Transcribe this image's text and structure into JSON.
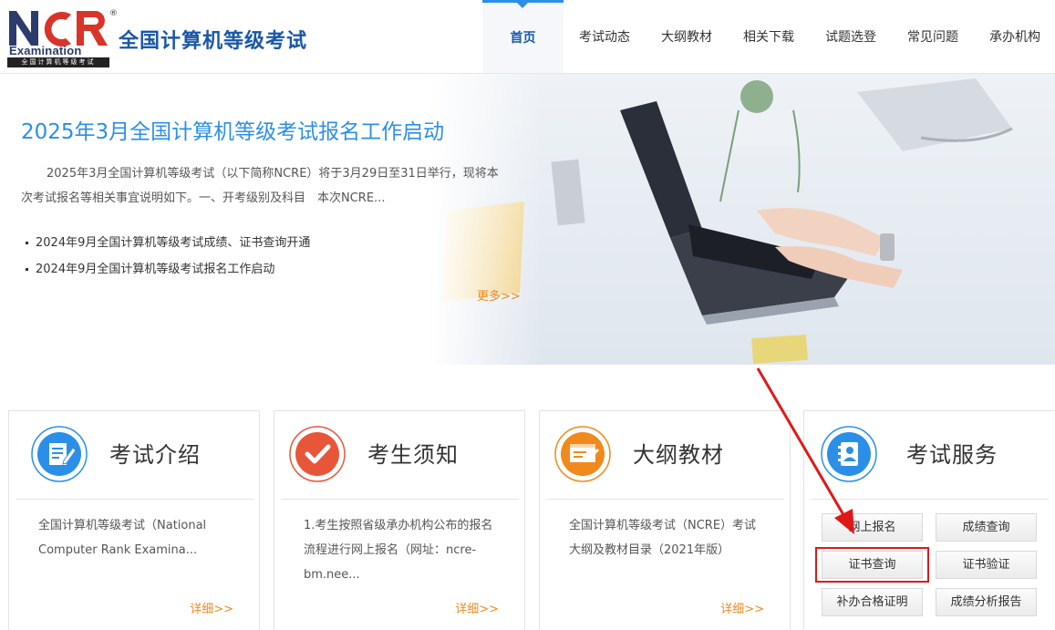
{
  "header": {
    "logo_letters": "NCR",
    "logo_examination": "Examination",
    "logo_strip": "全国计算机等级考试",
    "logo_registered": "®",
    "site_title": "全国计算机等级考试",
    "nav": [
      {
        "label": "首页",
        "active": true
      },
      {
        "label": "考试动态"
      },
      {
        "label": "大纲教材"
      },
      {
        "label": "相关下载"
      },
      {
        "label": "试题选登"
      },
      {
        "label": "常见问题"
      },
      {
        "label": "承办机构"
      }
    ]
  },
  "banner": {
    "headline": "2025年3月全国计算机等级考试报名工作启动",
    "summary": "2025年3月全国计算机等级考试（以下简称NCRE）将于3月29日至31日举行，现将本次考试报名等相关事宜说明如下。一、开考级别及科目　本次NCRE...",
    "news": [
      "2024年9月全国计算机等级考试成绩、证书查询开通",
      "2024年9月全国计算机等级考试报名工作启动"
    ],
    "more": "更多>>"
  },
  "cards": [
    {
      "title": "考试介绍",
      "icon": "pencil-document-icon",
      "color": "#2b8fe8",
      "body": "全国计算机等级考试（National Computer Rank Examina...",
      "detail": "详细>>"
    },
    {
      "title": "考生须知",
      "icon": "checkmark-icon",
      "color": "#e8563a",
      "body": "1.考生按照省级承办机构公布的报名流程进行网上报名（网址：ncre-bm.nee...",
      "detail": "详细>>"
    },
    {
      "title": "大纲教材",
      "icon": "syllabus-board-icon",
      "color": "#f08a1c",
      "body": "全国计算机等级考试（NCRE）考试大纲及教材目录（2021年版）",
      "detail": "详细>>"
    }
  ],
  "service": {
    "title": "考试服务",
    "icon": "contacts-book-icon",
    "color": "#2b8fe8",
    "buttons": [
      "网上报名",
      "成绩查询",
      "证书查询",
      "证书验证",
      "补办合格证明",
      "成绩分析报告"
    ]
  }
}
